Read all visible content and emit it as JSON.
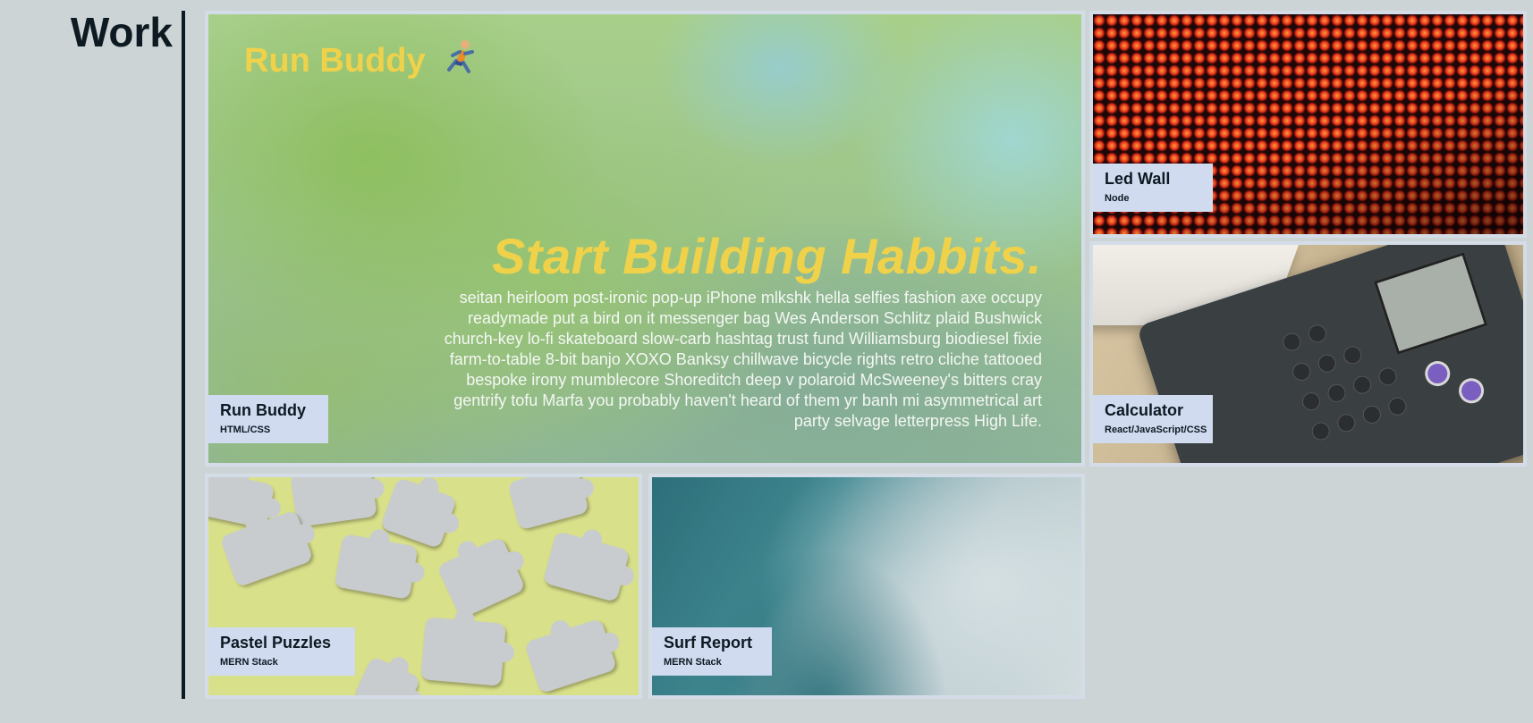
{
  "section": {
    "title": "Work"
  },
  "projects": [
    {
      "name": "Run Buddy",
      "stack": "HTML/CSS",
      "preview": {
        "logo": "Run Buddy",
        "logo_icon": "running-person-icon",
        "headline": "Start Building Habbits.",
        "body": "seitan heirloom post-ironic pop-up iPhone mlkshk hella selfies fashion axe occupy readymade put a bird on it messenger bag Wes Anderson Schlitz plaid Bushwick church-key lo-fi skateboard slow-carb hashtag trust fund Williamsburg biodiesel fixie farm-to-table 8-bit banjo XOXO Banksy chillwave bicycle rights retro cliche tattooed bespoke irony mumblecore Shoreditch deep v polaroid McSweeney's bitters cray gentrify tofu Marfa you probably haven't heard of them yr banh mi asymmetrical art party selvage letterpress High Life."
      }
    },
    {
      "name": "Led Wall",
      "stack": "Node"
    },
    {
      "name": "Calculator",
      "stack": "React/JavaScript/CSS"
    },
    {
      "name": "Pastel Puzzles",
      "stack": "MERN Stack"
    },
    {
      "name": "Surf Report",
      "stack": "MERN Stack"
    }
  ],
  "colors": {
    "background": "#ccd4d6",
    "label_bg": "#d0dbf0",
    "text_dark": "#0d1a22",
    "accent_yellow": "#f0d24a"
  }
}
